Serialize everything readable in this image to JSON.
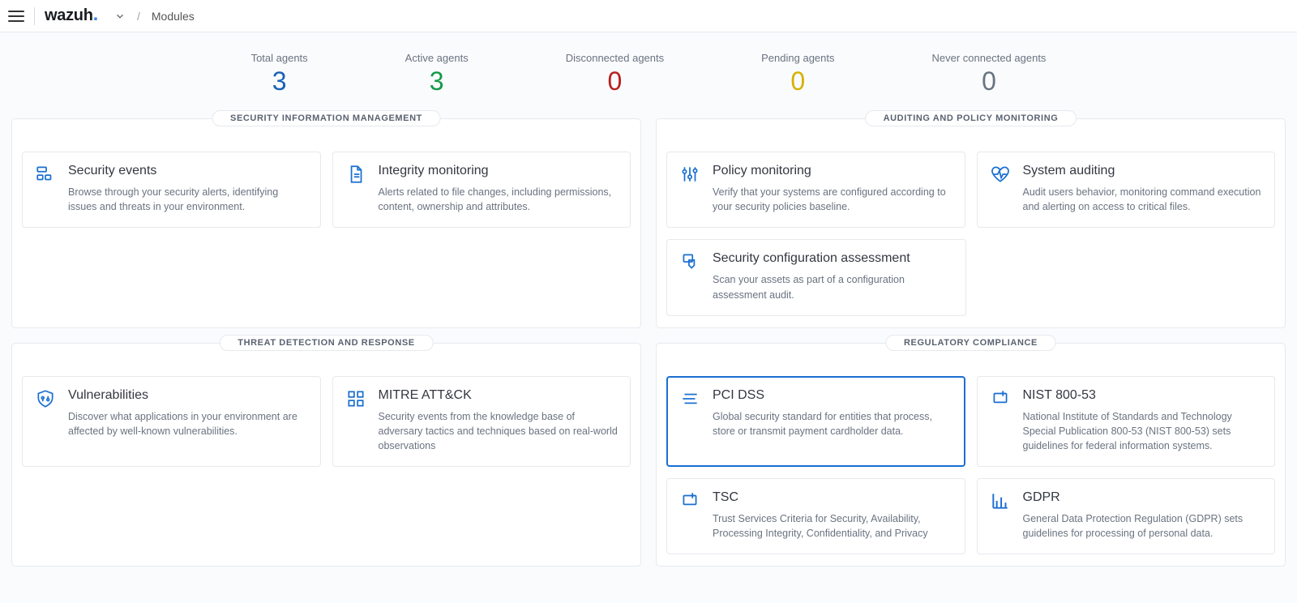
{
  "header": {
    "brand": "wazuh",
    "breadcrumb": "Modules"
  },
  "stats": {
    "total": {
      "label": "Total agents",
      "value": "3"
    },
    "active": {
      "label": "Active agents",
      "value": "3"
    },
    "disconnected": {
      "label": "Disconnected agents",
      "value": "0"
    },
    "pending": {
      "label": "Pending agents",
      "value": "0"
    },
    "never": {
      "label": "Never connected agents",
      "value": "0"
    }
  },
  "panels": {
    "sim": {
      "title": "SECURITY INFORMATION MANAGEMENT",
      "cards": {
        "security_events": {
          "title": "Security events",
          "desc": "Browse through your security alerts, identifying issues and threats in your environment."
        },
        "integrity_monitoring": {
          "title": "Integrity monitoring",
          "desc": "Alerts related to file changes, including permissions, content, ownership and attributes."
        }
      }
    },
    "apm": {
      "title": "AUDITING AND POLICY MONITORING",
      "cards": {
        "policy_monitoring": {
          "title": "Policy monitoring",
          "desc": "Verify that your systems are configured according to your security policies baseline."
        },
        "system_auditing": {
          "title": "System auditing",
          "desc": "Audit users behavior, monitoring command execution and alerting on access to critical files."
        },
        "sca": {
          "title": "Security configuration assessment",
          "desc": "Scan your assets as part of a configuration assessment audit."
        }
      }
    },
    "tdr": {
      "title": "THREAT DETECTION AND RESPONSE",
      "cards": {
        "vulnerabilities": {
          "title": "Vulnerabilities",
          "desc": "Discover what applications in your environment are affected by well-known vulnerabilities."
        },
        "mitre": {
          "title": "MITRE ATT&CK",
          "desc": "Security events from the knowledge base of adversary tactics and techniques based on real-world observations"
        }
      }
    },
    "rc": {
      "title": "REGULATORY COMPLIANCE",
      "cards": {
        "pci": {
          "title": "PCI DSS",
          "desc": "Global security standard for entities that process, store or transmit payment cardholder data."
        },
        "nist": {
          "title": "NIST 800-53",
          "desc": "National Institute of Standards and Technology Special Publication 800-53 (NIST 800-53) sets guidelines for federal information systems."
        },
        "tsc": {
          "title": "TSC",
          "desc": "Trust Services Criteria for Security, Availability, Processing Integrity, Confidentiality, and Privacy"
        },
        "gdpr": {
          "title": "GDPR",
          "desc": "General Data Protection Regulation (GDPR) sets guidelines for processing of personal data."
        }
      }
    }
  }
}
